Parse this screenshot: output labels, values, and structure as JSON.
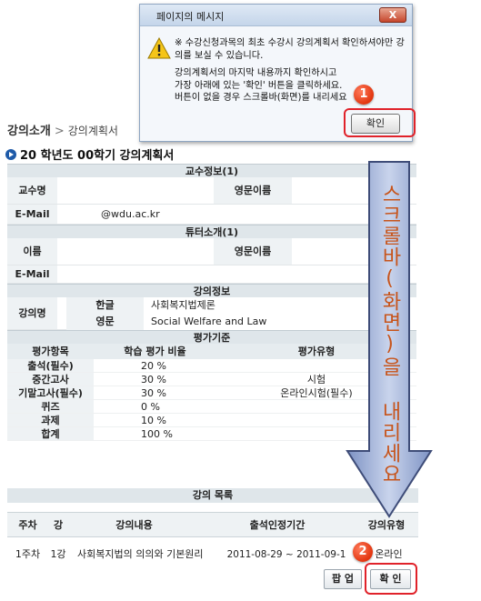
{
  "dialog": {
    "title": "페이지의 메시지",
    "close_label": "X",
    "message_1": "※ 수강신청과목의 최초 수강시 강의계획서  확인하셔야만 강\n의를 보실 수 있습니다.",
    "message_2": "강의계획서의 마지막 내용까지 확인하시고\n가장 아래에 있는 '확인' 버튼을 클릭하세요.\n버튼이 없을 경우 스크롤바(화면)를 내리세요",
    "ok_label": "확인"
  },
  "annotations": {
    "step1": "1",
    "step2": "2",
    "scroll_hint": "스크롤바(화면)을 내리세요",
    "accent_color": "#e0222a",
    "arrow_color": "#8da0cf"
  },
  "breadcrumb": {
    "root": "강의소개",
    "sep": ">",
    "current": "강의계획서"
  },
  "page_title": "20   학년도 00학기 강의계획서",
  "professor": {
    "section": "교수정보(1)",
    "name_label": "교수명",
    "name_value": "",
    "eng_label": "영문이름",
    "eng_value": "",
    "email_label": "E-Mail",
    "email_value": "@wdu.ac.kr"
  },
  "tutor": {
    "section": "튜터소개(1)",
    "name_label": "이름",
    "name_value": "",
    "eng_label": "영문이름",
    "eng_value": "",
    "email_label": "E-Mail",
    "email_value": ""
  },
  "course": {
    "section": "강의정보",
    "name_label": "강의명",
    "kor_label": "한글",
    "kor_value": "사회복지법제론",
    "eng_label": "영문",
    "eng_value": "Social Welfare and Law"
  },
  "evaluation": {
    "section": "평가기준",
    "headers": [
      "평가항목",
      "학습 평가 비율",
      "평가유형"
    ],
    "rows": [
      [
        "출석(필수)",
        "20 %",
        ""
      ],
      [
        "중간고사",
        "30 %",
        "시험"
      ],
      [
        "기말고사(필수)",
        "30 %",
        "온라인시험(필수)"
      ],
      [
        "퀴즈",
        "0 %",
        ""
      ],
      [
        "과제",
        "10 %",
        ""
      ],
      [
        "합계",
        "100 %",
        ""
      ]
    ]
  },
  "lecture_list": {
    "section": "강의 목록",
    "headers": [
      "주차",
      "강",
      "강의내용",
      "출석인정기간",
      "강의유형"
    ],
    "rows": [
      [
        "1주차",
        "1강",
        "사회복지법의 의의와 기본원리",
        "2011-08-29 ~ 2011-09-1",
        "온라인"
      ]
    ]
  },
  "buttons": {
    "popup_label": "팝 업",
    "confirm_label": "확 인"
  }
}
